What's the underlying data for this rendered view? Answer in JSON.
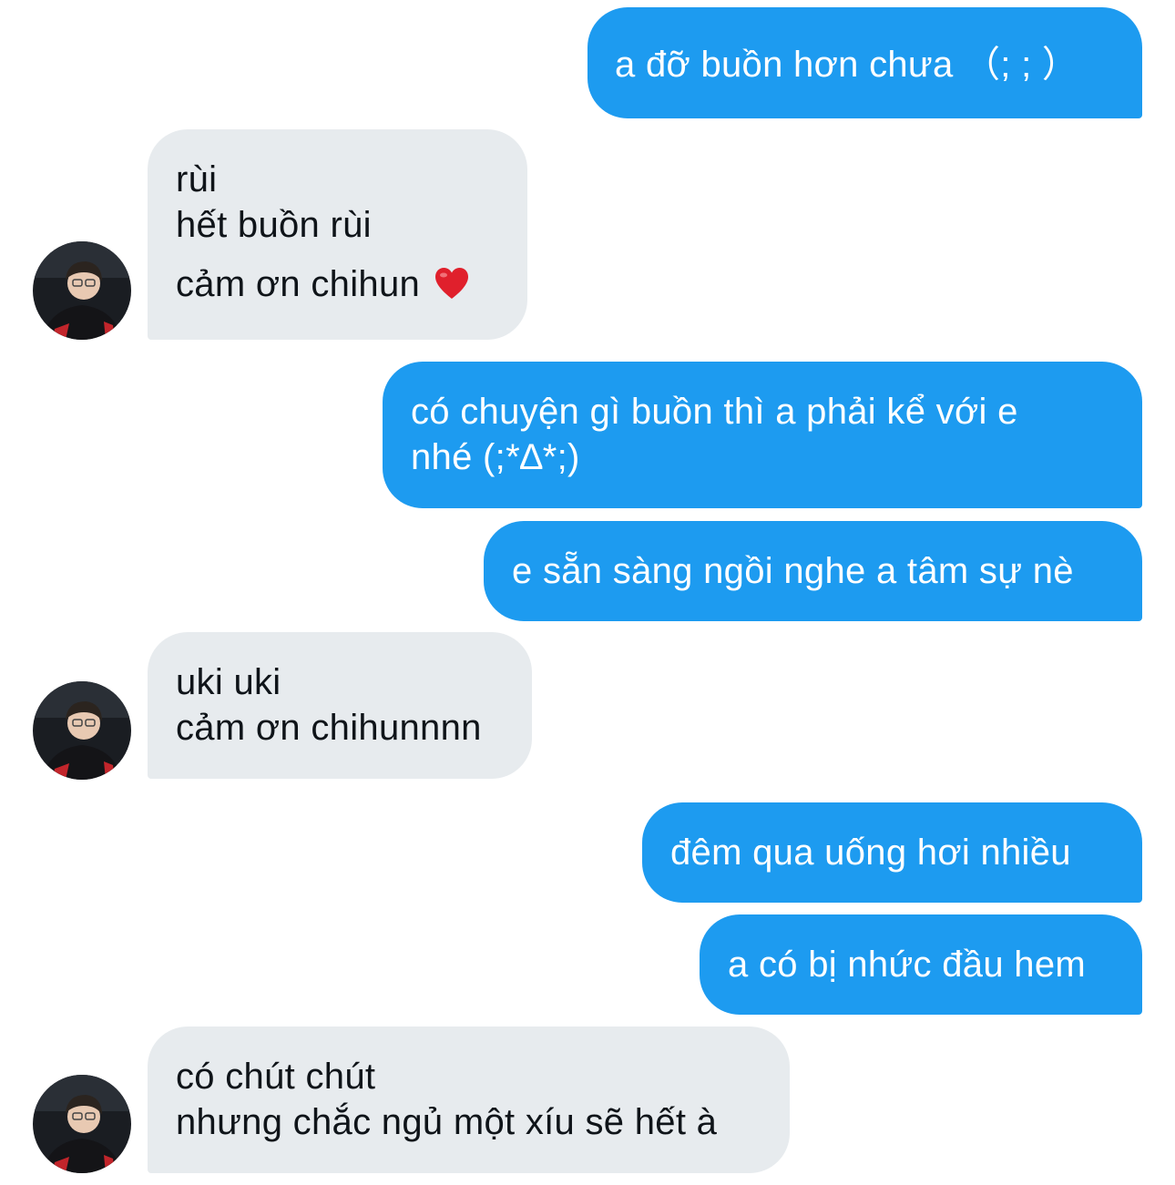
{
  "conversation": {
    "messages": [
      {
        "from": "me",
        "lines": [
          "a đỡ buồn hơn chưa （; ; ）"
        ]
      },
      {
        "from": "them",
        "lines": [
          "rùi",
          "hết buồn rùi",
          "cảm ơn chihun"
        ]
      },
      {
        "from": "me",
        "lines": [
          "có chuyện gì buồn thì a phải kể với e",
          "nhé (;*∆*;)"
        ]
      },
      {
        "from": "me",
        "lines": [
          "e sẵn sàng ngồi nghe a tâm sự nè"
        ]
      },
      {
        "from": "them",
        "lines": [
          "uki uki",
          "cảm ơn chihunnnn"
        ]
      },
      {
        "from": "me",
        "lines": [
          "đêm qua uống hơi nhiều"
        ]
      },
      {
        "from": "me",
        "lines": [
          "a có bị nhức đầu hem"
        ]
      },
      {
        "from": "them",
        "lines": [
          "có chút chút",
          "nhưng chắc ngủ một xíu sẽ hết à"
        ]
      }
    ],
    "emoji": {
      "heart": "heart-emoji"
    },
    "colors": {
      "sent_bubble": "#1d9bf0",
      "received_bubble": "#e7ebee",
      "heart": "#e0202c"
    }
  }
}
